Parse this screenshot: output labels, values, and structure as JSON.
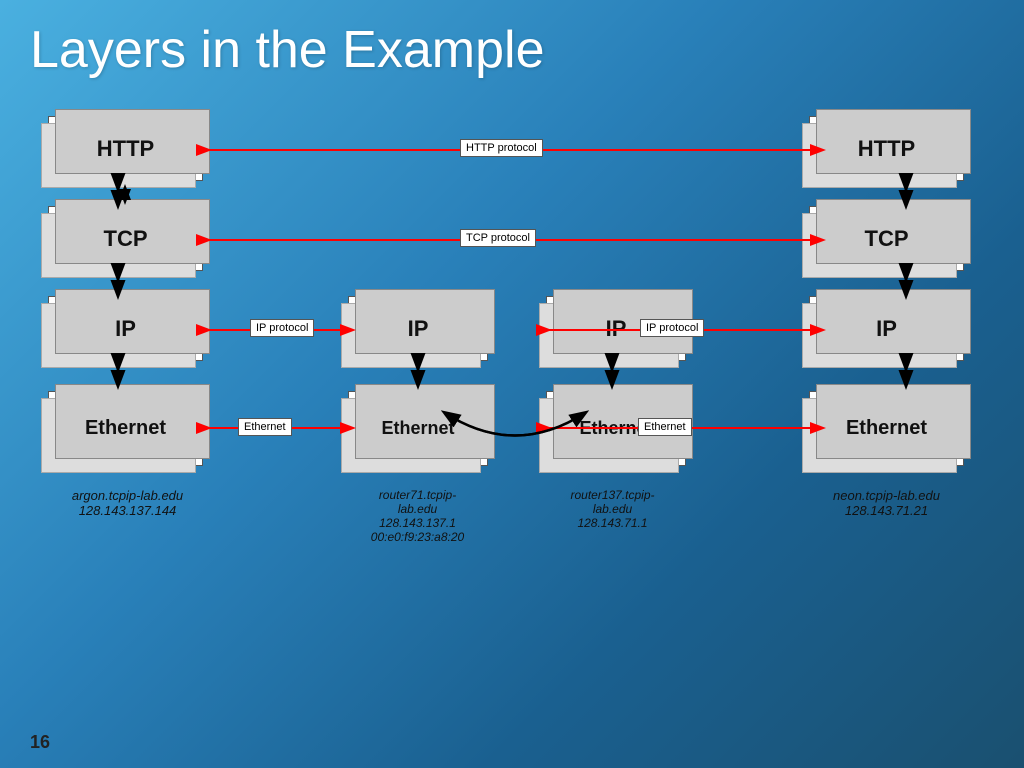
{
  "title": "Layers in the Example",
  "slide_number": "16",
  "nodes": {
    "left": {
      "label": "argon.tcpip-lab.edu\n128.143.137.144",
      "layers": [
        "HTTP",
        "TCP",
        "IP",
        "Ethernet"
      ]
    },
    "router1": {
      "label": "router71.tcpip-lab.edu\n128.143.137.1\n00:e0:f9:23:a8:20",
      "layers": [
        "IP",
        "Ethernet"
      ]
    },
    "router2": {
      "label": "router137.tcpip-lab.edu\n128.143.71.1",
      "layers": [
        "IP",
        "Ethernet"
      ]
    },
    "right": {
      "label": "neon.tcpip-lab.edu\n128.143.71.21",
      "layers": [
        "HTTP",
        "TCP",
        "IP",
        "Ethernet"
      ]
    }
  },
  "protocols": {
    "http": "HTTP protocol",
    "tcp": "TCP protocol",
    "ip": "IP protocol",
    "ethernet": "Ethernet"
  }
}
